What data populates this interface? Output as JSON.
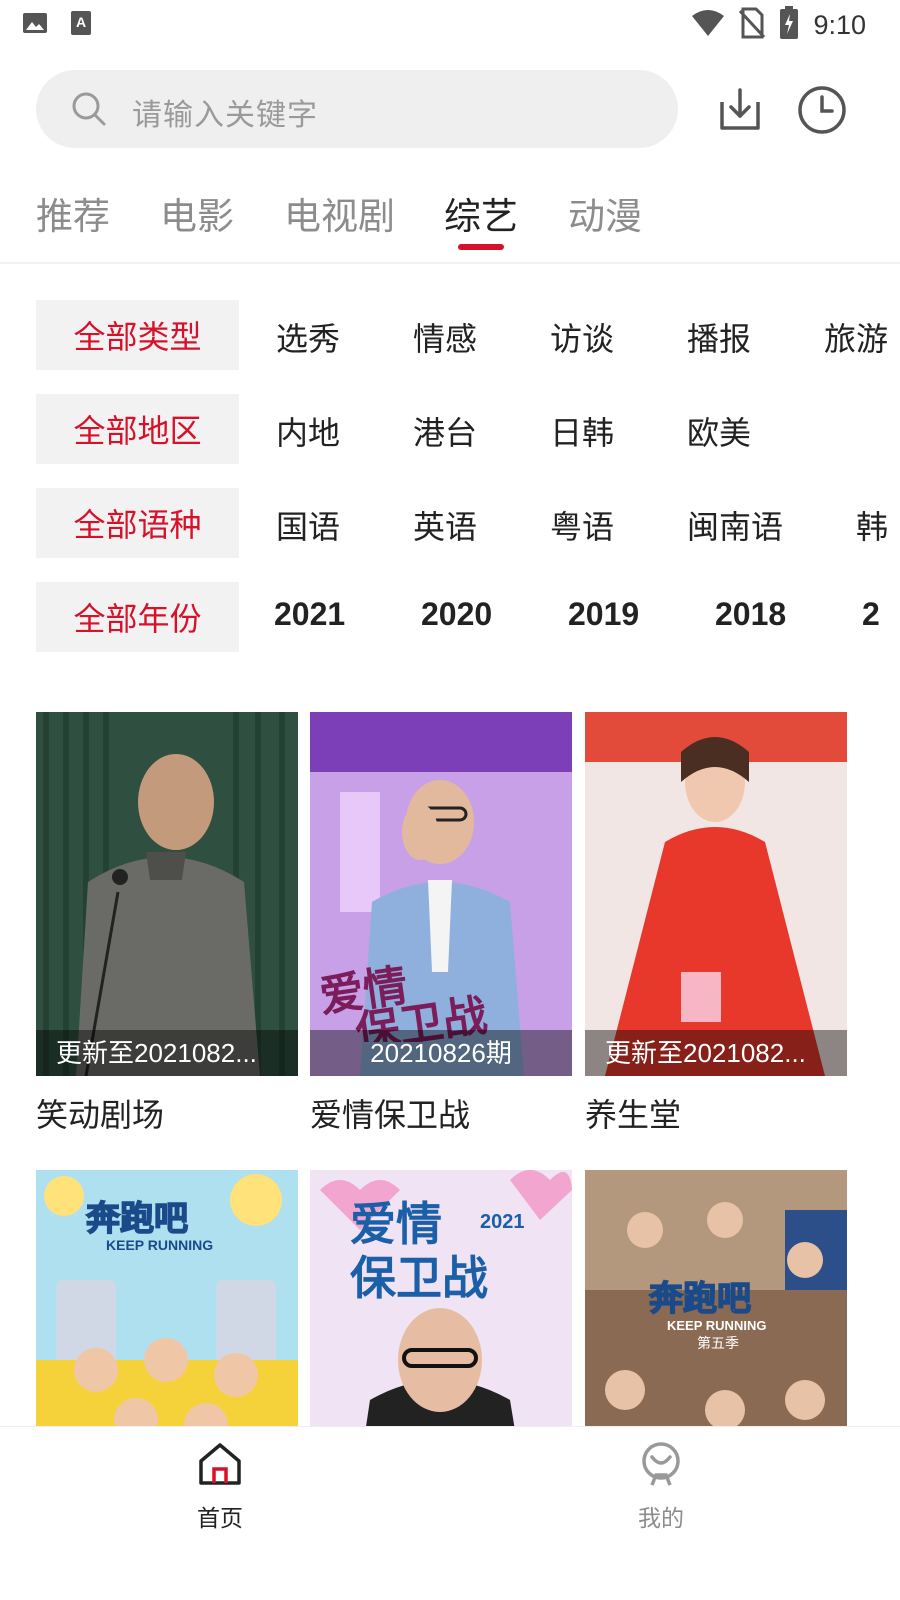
{
  "status_bar": {
    "time": "9:10",
    "icons": [
      "gallery-icon",
      "keyboard-a-icon",
      "wifi-icon",
      "no-sim-icon",
      "battery-charging-icon"
    ]
  },
  "search": {
    "placeholder": "请输入关键字",
    "download_icon": "download-icon",
    "history_icon": "history-clock-icon"
  },
  "tabs": [
    {
      "label": "推荐",
      "active": false
    },
    {
      "label": "电影",
      "active": false
    },
    {
      "label": "电视剧",
      "active": false
    },
    {
      "label": "综艺",
      "active": true
    },
    {
      "label": "动漫",
      "active": false
    }
  ],
  "filters": {
    "type": {
      "all": "全部类型",
      "options": [
        "选秀",
        "情感",
        "访谈",
        "播报",
        "旅游"
      ]
    },
    "region": {
      "all": "全部地区",
      "options": [
        "内地",
        "港台",
        "日韩",
        "欧美"
      ]
    },
    "language": {
      "all": "全部语种",
      "options": [
        "国语",
        "英语",
        "粤语",
        "闽南语",
        "韩"
      ]
    },
    "year": {
      "all": "全部年份",
      "options": [
        "2021",
        "2020",
        "2019",
        "2018",
        "2"
      ]
    }
  },
  "cards": [
    {
      "title": "笑动剧场",
      "caption": "更新至2021082...",
      "poster": "man-grey-gown-on-stage-poster"
    },
    {
      "title": "爱情保卫战",
      "caption": "20210826期",
      "poster": "aiqing-baoweizhan-host-poster",
      "poster_text": "爱情保卫战"
    },
    {
      "title": "养生堂",
      "caption": "更新至2021082...",
      "poster": "woman-red-dress-poster"
    },
    {
      "title": "",
      "caption": "",
      "poster": "keep-running-yellow-poster",
      "poster_text": "奔跑吧 KEEP RUNNING"
    },
    {
      "title": "",
      "caption": "",
      "poster": "aiqing-baoweizhan-2021-poster",
      "poster_text": "爱情保卫战 2021"
    },
    {
      "title": "",
      "caption": "",
      "poster": "keep-running-season5-poster",
      "poster_text": "奔跑吧 KEEP RUNNING 第五季"
    }
  ],
  "bottom_nav": [
    {
      "label": "首页",
      "icon": "home-icon",
      "active": true
    },
    {
      "label": "我的",
      "icon": "profile-icon",
      "active": false
    }
  ],
  "colors": {
    "accent": "#d7112a",
    "inactive": "#8c8c8c",
    "search_bg": "#efefef",
    "filter_bg": "#f2f2f2"
  }
}
